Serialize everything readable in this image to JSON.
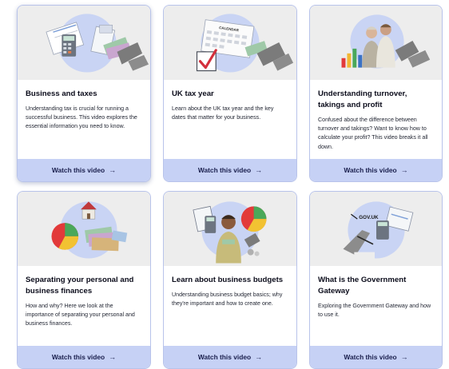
{
  "cards": [
    {
      "title": "Business and taxes",
      "description": "Understanding tax is crucial for running a successful business. This video explores the essential information you need to know.",
      "cta_label": "Watch this video",
      "cta_arrow": "→",
      "image_icon": "calculator-money-illustration"
    },
    {
      "title": "UK tax year",
      "description": "Learn about the UK tax year and the key dates that matter for your business.",
      "cta_label": "Watch this video",
      "cta_arrow": "→",
      "image_icon": "calendar-checkbox-illustration",
      "image_text": "CALENDAR"
    },
    {
      "title": "Understanding turnover, takings and profit",
      "description": "Confused about the difference between turnover and takings? Want to know how to calculate your profit? This video breaks it all down.",
      "cta_label": "Watch this video",
      "cta_arrow": "→",
      "image_icon": "business-owners-chart-illustration"
    },
    {
      "title": "Separating your personal and business finances",
      "description": "How and why? Here we look at the importance of separating your personal and business finances.",
      "cta_label": "Watch this video",
      "cta_arrow": "→",
      "image_icon": "house-pie-chart-illustration"
    },
    {
      "title": "Learn about business budgets",
      "description": "Understanding business budget basics; why they're important and how to create one.",
      "cta_label": "Watch this video",
      "cta_arrow": "→",
      "image_icon": "person-budget-illustration"
    },
    {
      "title": "What is the Government Gateway",
      "description": "Exploring the Government Gateway and how to use it.",
      "cta_label": "Watch this video",
      "cta_arrow": "→",
      "image_icon": "gov-uk-gateway-illustration",
      "image_text": "GOV.UK"
    }
  ],
  "colors": {
    "card_border": "#b8c3ea",
    "cta_background": "#c6d1f5",
    "cta_text": "#1a1f4d",
    "image_background": "#ededed",
    "accent_circle": "#c9d4f4"
  }
}
